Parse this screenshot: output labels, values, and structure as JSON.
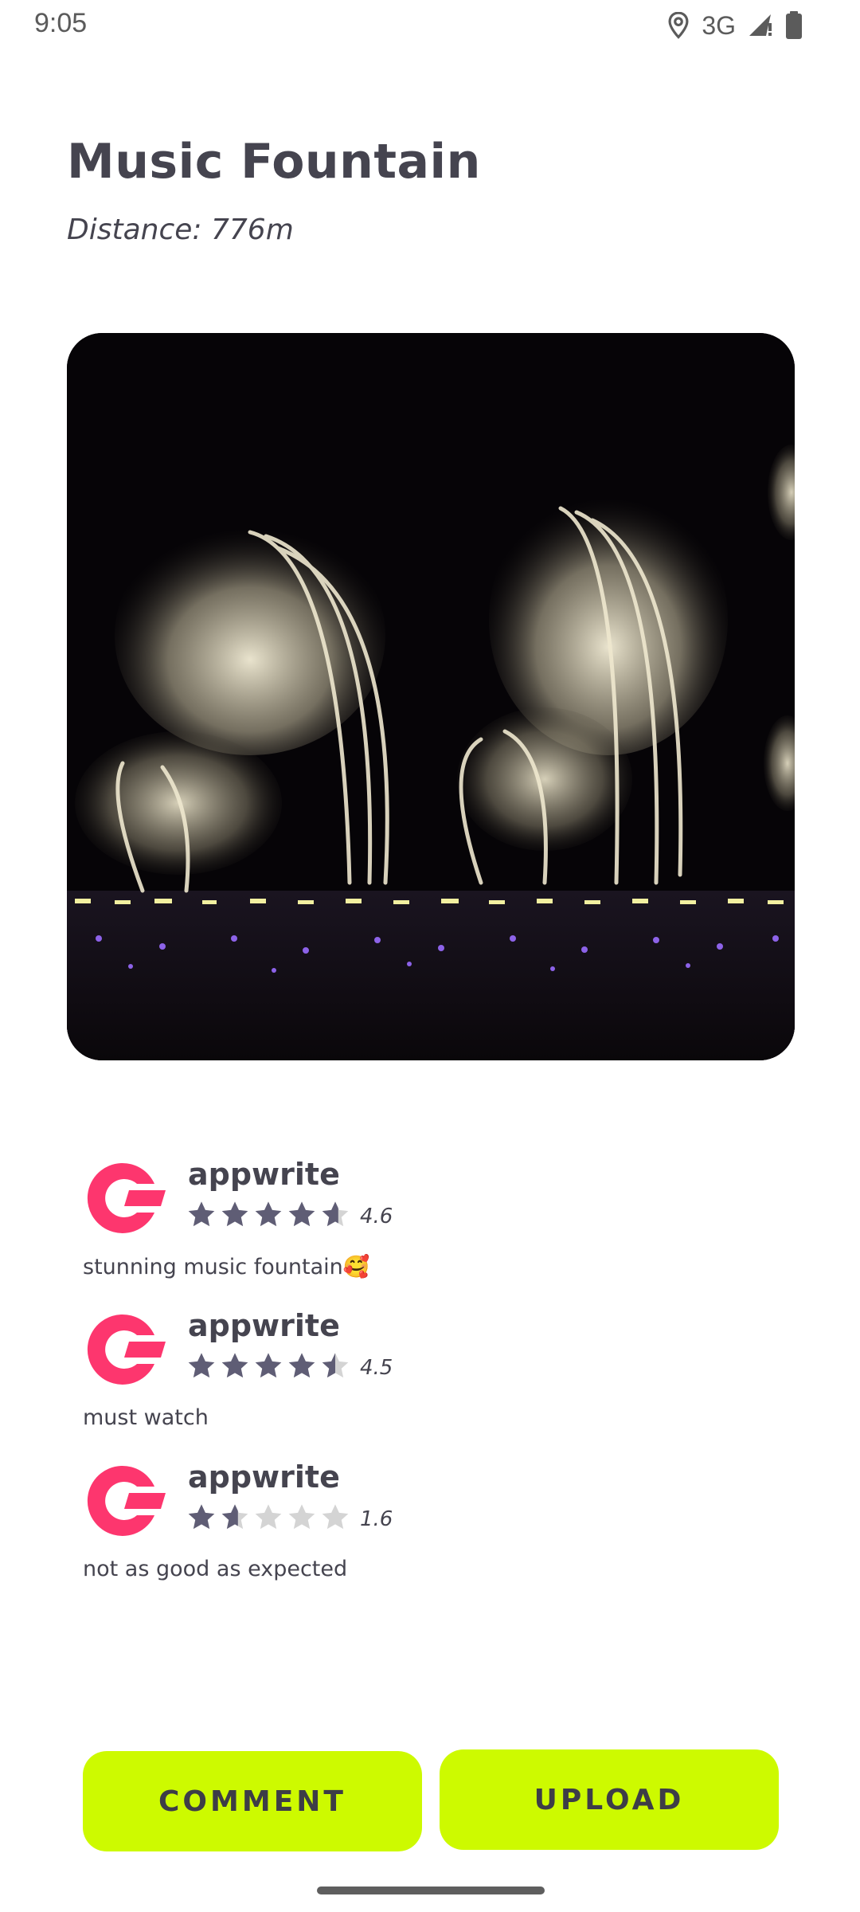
{
  "status_bar": {
    "time": "9:05",
    "network": "3G",
    "icons": [
      "location-icon",
      "signal-icon",
      "battery-icon"
    ]
  },
  "place": {
    "title": "Music Fountain",
    "distance": "Distance: 776m"
  },
  "colors": {
    "accent": "#cdfa00",
    "text": "#45444f",
    "avatar": "#fd366e",
    "star_filled": "#5f5d75",
    "star_empty": "#d4d4d4"
  },
  "reviews": [
    {
      "name": "appwrite",
      "rating": 4.6,
      "rating_label": "4.6",
      "comment": "stunning music fountain🥰"
    },
    {
      "name": "appwrite",
      "rating": 4.5,
      "rating_label": "4.5",
      "comment": "must watch"
    },
    {
      "name": "appwrite",
      "rating": 1.6,
      "rating_label": "1.6",
      "comment": "not as good as expected"
    }
  ],
  "buttons": {
    "comment": "COMMENT",
    "upload": "UPLOAD"
  }
}
